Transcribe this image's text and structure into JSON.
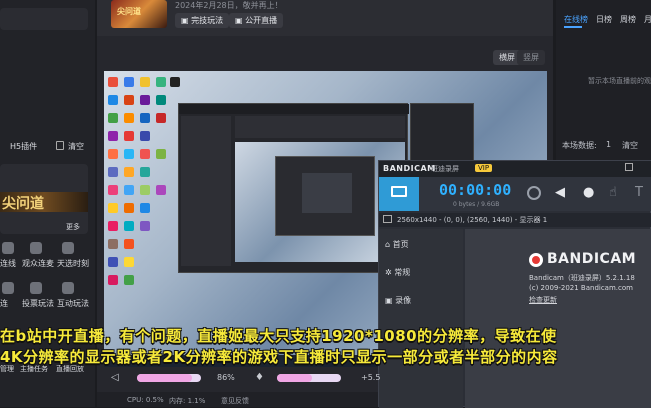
{
  "left": {
    "h5_label": "H5插件",
    "clear_label": "清空",
    "banner_text": "尖问道",
    "more_label": "更多",
    "grid_row1": [
      "连线",
      "观众连麦",
      "天选时刻"
    ],
    "grid_row2": [
      "连",
      "投票玩法",
      "互动玩法"
    ],
    "grid_row3": [
      "管理",
      "主播任务",
      "直播回放"
    ]
  },
  "header": {
    "title_partial": "2024年2月28日，敬并再上！",
    "thumb_text": "尖问道",
    "buttons": [
      "完技玩法",
      "公开直播"
    ]
  },
  "preview": {
    "tabs": [
      "横屏",
      "竖屏"
    ]
  },
  "right": {
    "tabs": [
      "在线榜",
      "日榜",
      "周榜",
      "月"
    ],
    "empty_hint": "暂示本场直播前的观众",
    "count_label": "本场数据:",
    "count_value": "1",
    "clear_label": "清空"
  },
  "bandicam": {
    "title": "BANDICAM",
    "edition": "班迪录屏",
    "vip": "VIP",
    "timer": "00:00:00",
    "rate": "0 bytes / 9.6GB",
    "resolution_line": "2560x1440 - (0, 0), (2560, 1440) - 显示器 1",
    "nav": [
      "首页",
      "常规",
      "录像"
    ],
    "logo": "BANDICAM",
    "product": "Bandicam（班迪录屏）5.2.1.18",
    "copyright": "(c) 2009-2021 Bandicam.com",
    "update": "检查更新"
  },
  "subtitles": {
    "line1": "在b站中开直播，有个问题，直播姬最大只支持1920*1080的分辨率，导致在使",
    "line2": "4K分辨率的显示器或者2K分辨率的游戏下直播时只显示一部分或者半部分的内容"
  },
  "audio": {
    "volume_percent": 86,
    "volume_label": "86%",
    "gain_label": "+5.5",
    "mic_level": 0.55
  },
  "status": {
    "cpu": "CPU: 0.5%",
    "mem": "内存: 1.1%",
    "feedback": "意见反馈"
  }
}
